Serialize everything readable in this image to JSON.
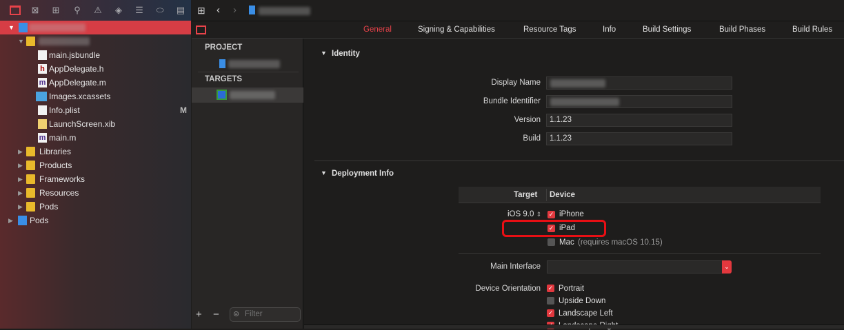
{
  "navigator": {
    "toolbar_icons": [
      "folder-icon",
      "source-control-icon",
      "hierarchy-icon",
      "search-icon",
      "warning-icon",
      "test-icon",
      "debug-icon",
      "breakpoint-icon",
      "report-icon"
    ],
    "items": [
      {
        "label": "main.jsbundle",
        "badge": ""
      },
      {
        "label": "AppDelegate.h",
        "badge": ""
      },
      {
        "label": "AppDelegate.m",
        "badge": ""
      },
      {
        "label": "Images.xcassets",
        "badge": ""
      },
      {
        "label": "Info.plist",
        "badge": "M"
      },
      {
        "label": "LaunchScreen.xib",
        "badge": ""
      },
      {
        "label": "main.m",
        "badge": ""
      },
      {
        "label": "Libraries"
      },
      {
        "label": "Products"
      },
      {
        "label": "Frameworks"
      },
      {
        "label": "Resources"
      },
      {
        "label": "Pods"
      },
      {
        "label": "Pods"
      }
    ]
  },
  "tabs": [
    "General",
    "Signing & Capabilities",
    "Resource Tags",
    "Info",
    "Build Settings",
    "Build Phases",
    "Build Rules"
  ],
  "side": {
    "project": "PROJECT",
    "targets": "TARGETS",
    "filter_placeholder": "Filter",
    "add": "+",
    "remove": "−"
  },
  "identity": {
    "title": "Identity",
    "display_name_label": "Display Name",
    "bundle_id_label": "Bundle Identifier",
    "version_label": "Version",
    "version": "1.1.23",
    "build_label": "Build",
    "build": "1.1.23"
  },
  "deployment": {
    "title": "Deployment Info",
    "target_header": "Target",
    "device_header": "Device",
    "ios": "iOS 9.0",
    "iphone": "iPhone",
    "ipad": "iPad",
    "mac": "Mac",
    "mac_note": "(requires macOS 10.15)",
    "main_interface_label": "Main Interface",
    "orientation_label": "Device Orientation",
    "portrait": "Portrait",
    "upside_down": "Upside Down",
    "landscape_left": "Landscape Left",
    "landscape_right": "Landscape Right"
  },
  "colors": {
    "accent": "#e2383e",
    "selection": "#d63d45"
  }
}
